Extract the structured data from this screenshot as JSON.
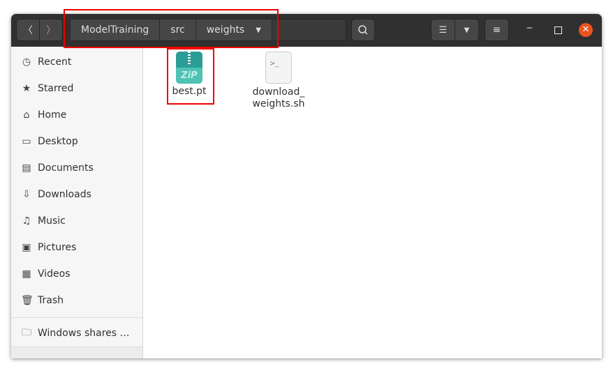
{
  "breadcrumb": [
    "ModelTraining",
    "src",
    "weights"
  ],
  "sidebar": {
    "items": [
      {
        "label": "Recent",
        "icon": "clock-icon"
      },
      {
        "label": "Starred",
        "icon": "star-icon"
      },
      {
        "label": "Home",
        "icon": "home-icon"
      },
      {
        "label": "Desktop",
        "icon": "desktop-icon"
      },
      {
        "label": "Documents",
        "icon": "document-icon"
      },
      {
        "label": "Downloads",
        "icon": "download-icon"
      },
      {
        "label": "Music",
        "icon": "music-icon"
      },
      {
        "label": "Pictures",
        "icon": "picture-icon"
      },
      {
        "label": "Videos",
        "icon": "video-icon"
      },
      {
        "label": "Trash",
        "icon": "trash-icon"
      }
    ],
    "network": "Windows shares …"
  },
  "files": [
    {
      "name": "best.pt",
      "icon_text": "ZiP"
    },
    {
      "name": "download_\nweights.sh",
      "icon_text": ">_"
    }
  ],
  "colors": {
    "header": "#303030",
    "close": "#e95420",
    "zip": "#2aa198"
  }
}
